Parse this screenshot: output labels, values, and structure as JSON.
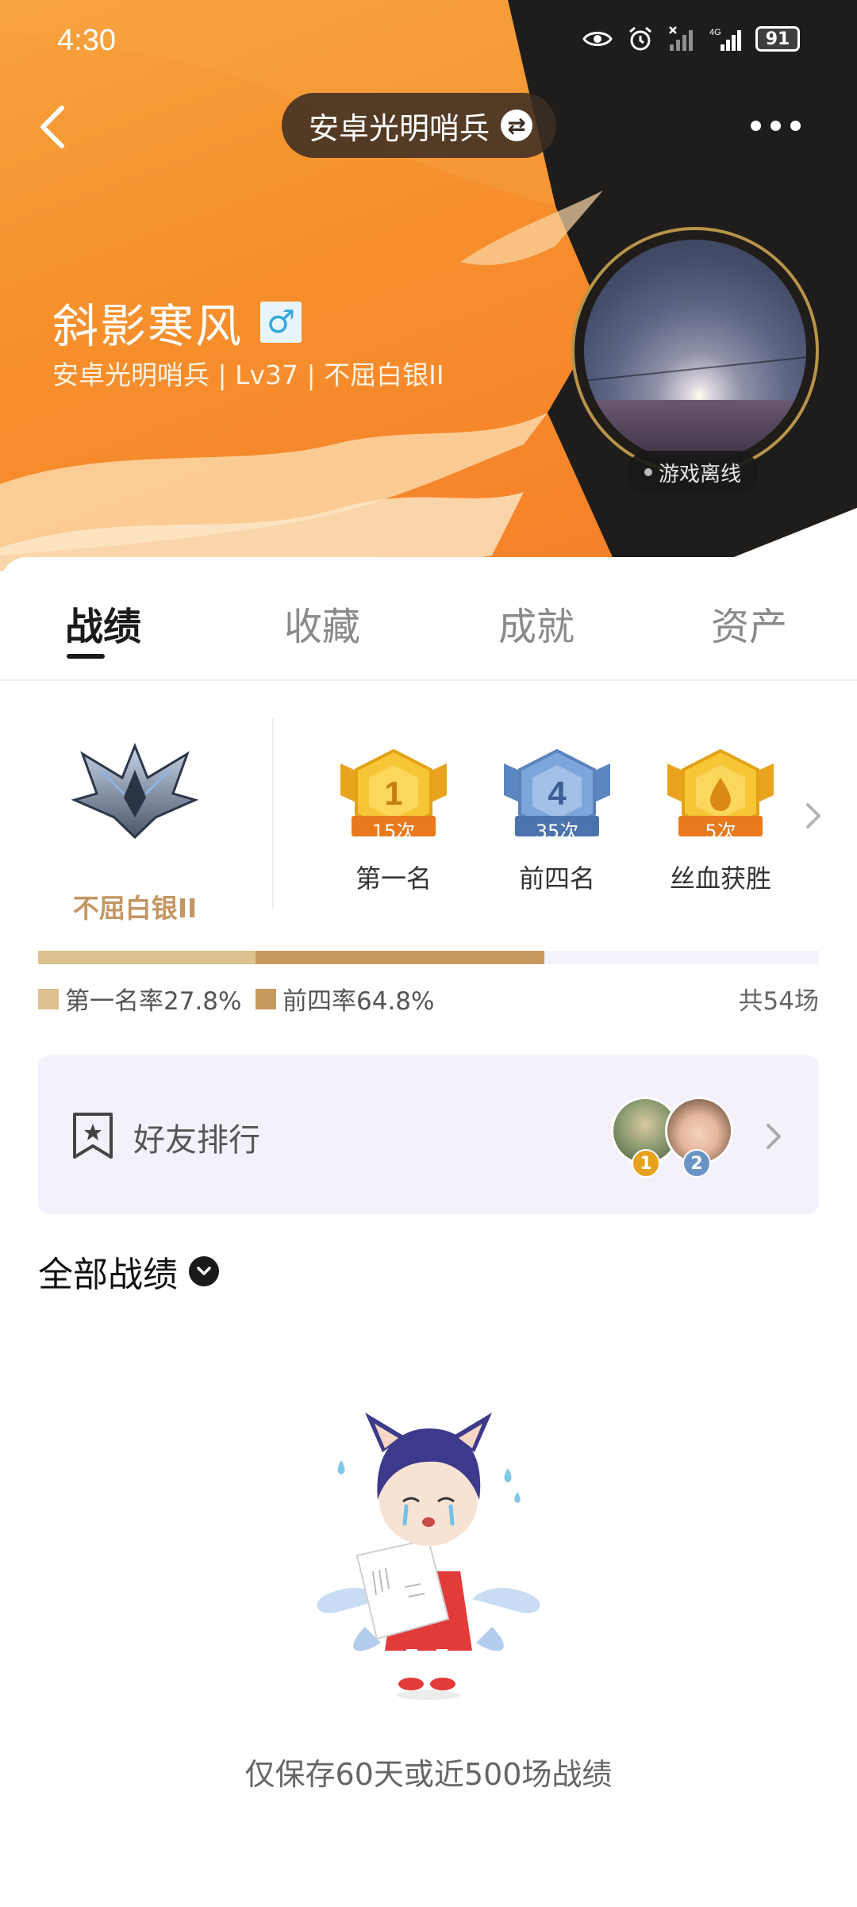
{
  "status_bar": {
    "time": "4:30",
    "battery": "91",
    "network": "4G"
  },
  "header": {
    "title": "安卓光明哨兵",
    "player_name": "斜影寒风",
    "gender_symbol": "♂",
    "sub_info": "安卓光明哨兵 | Lv37 | 不屈白银II",
    "avatar_status": "游戏离线"
  },
  "tabs": [
    {
      "label": "战绩",
      "active": true
    },
    {
      "label": "收藏",
      "active": false
    },
    {
      "label": "成就",
      "active": false
    },
    {
      "label": "资产",
      "active": false
    }
  ],
  "rank": {
    "name": "不屈白银II"
  },
  "medals": [
    {
      "label": "第一名",
      "count": "15次",
      "number": "1",
      "color": "#f1b82b"
    },
    {
      "label": "前四名",
      "count": "35次",
      "number": "4",
      "color": "#6f97cf"
    },
    {
      "label": "丝血获胜",
      "count": "5次",
      "number": "",
      "color": "#f1b82b"
    }
  ],
  "stats": {
    "first_rate_label": "第一名率27.8%",
    "first_rate": 27.8,
    "top4_rate_label": "前四率64.8%",
    "top4_rate": 64.8,
    "total_label": "共54场",
    "colors": {
      "first": "#dcc08e",
      "top4": "#c7995f",
      "track": "#f4f2fa"
    }
  },
  "friend_rank": {
    "label": "好友排行",
    "friends": [
      {
        "rank": "1"
      },
      {
        "rank": "2"
      }
    ]
  },
  "records": {
    "title": "全部战绩",
    "empty_text": "仅保存60天或近500场战绩"
  }
}
